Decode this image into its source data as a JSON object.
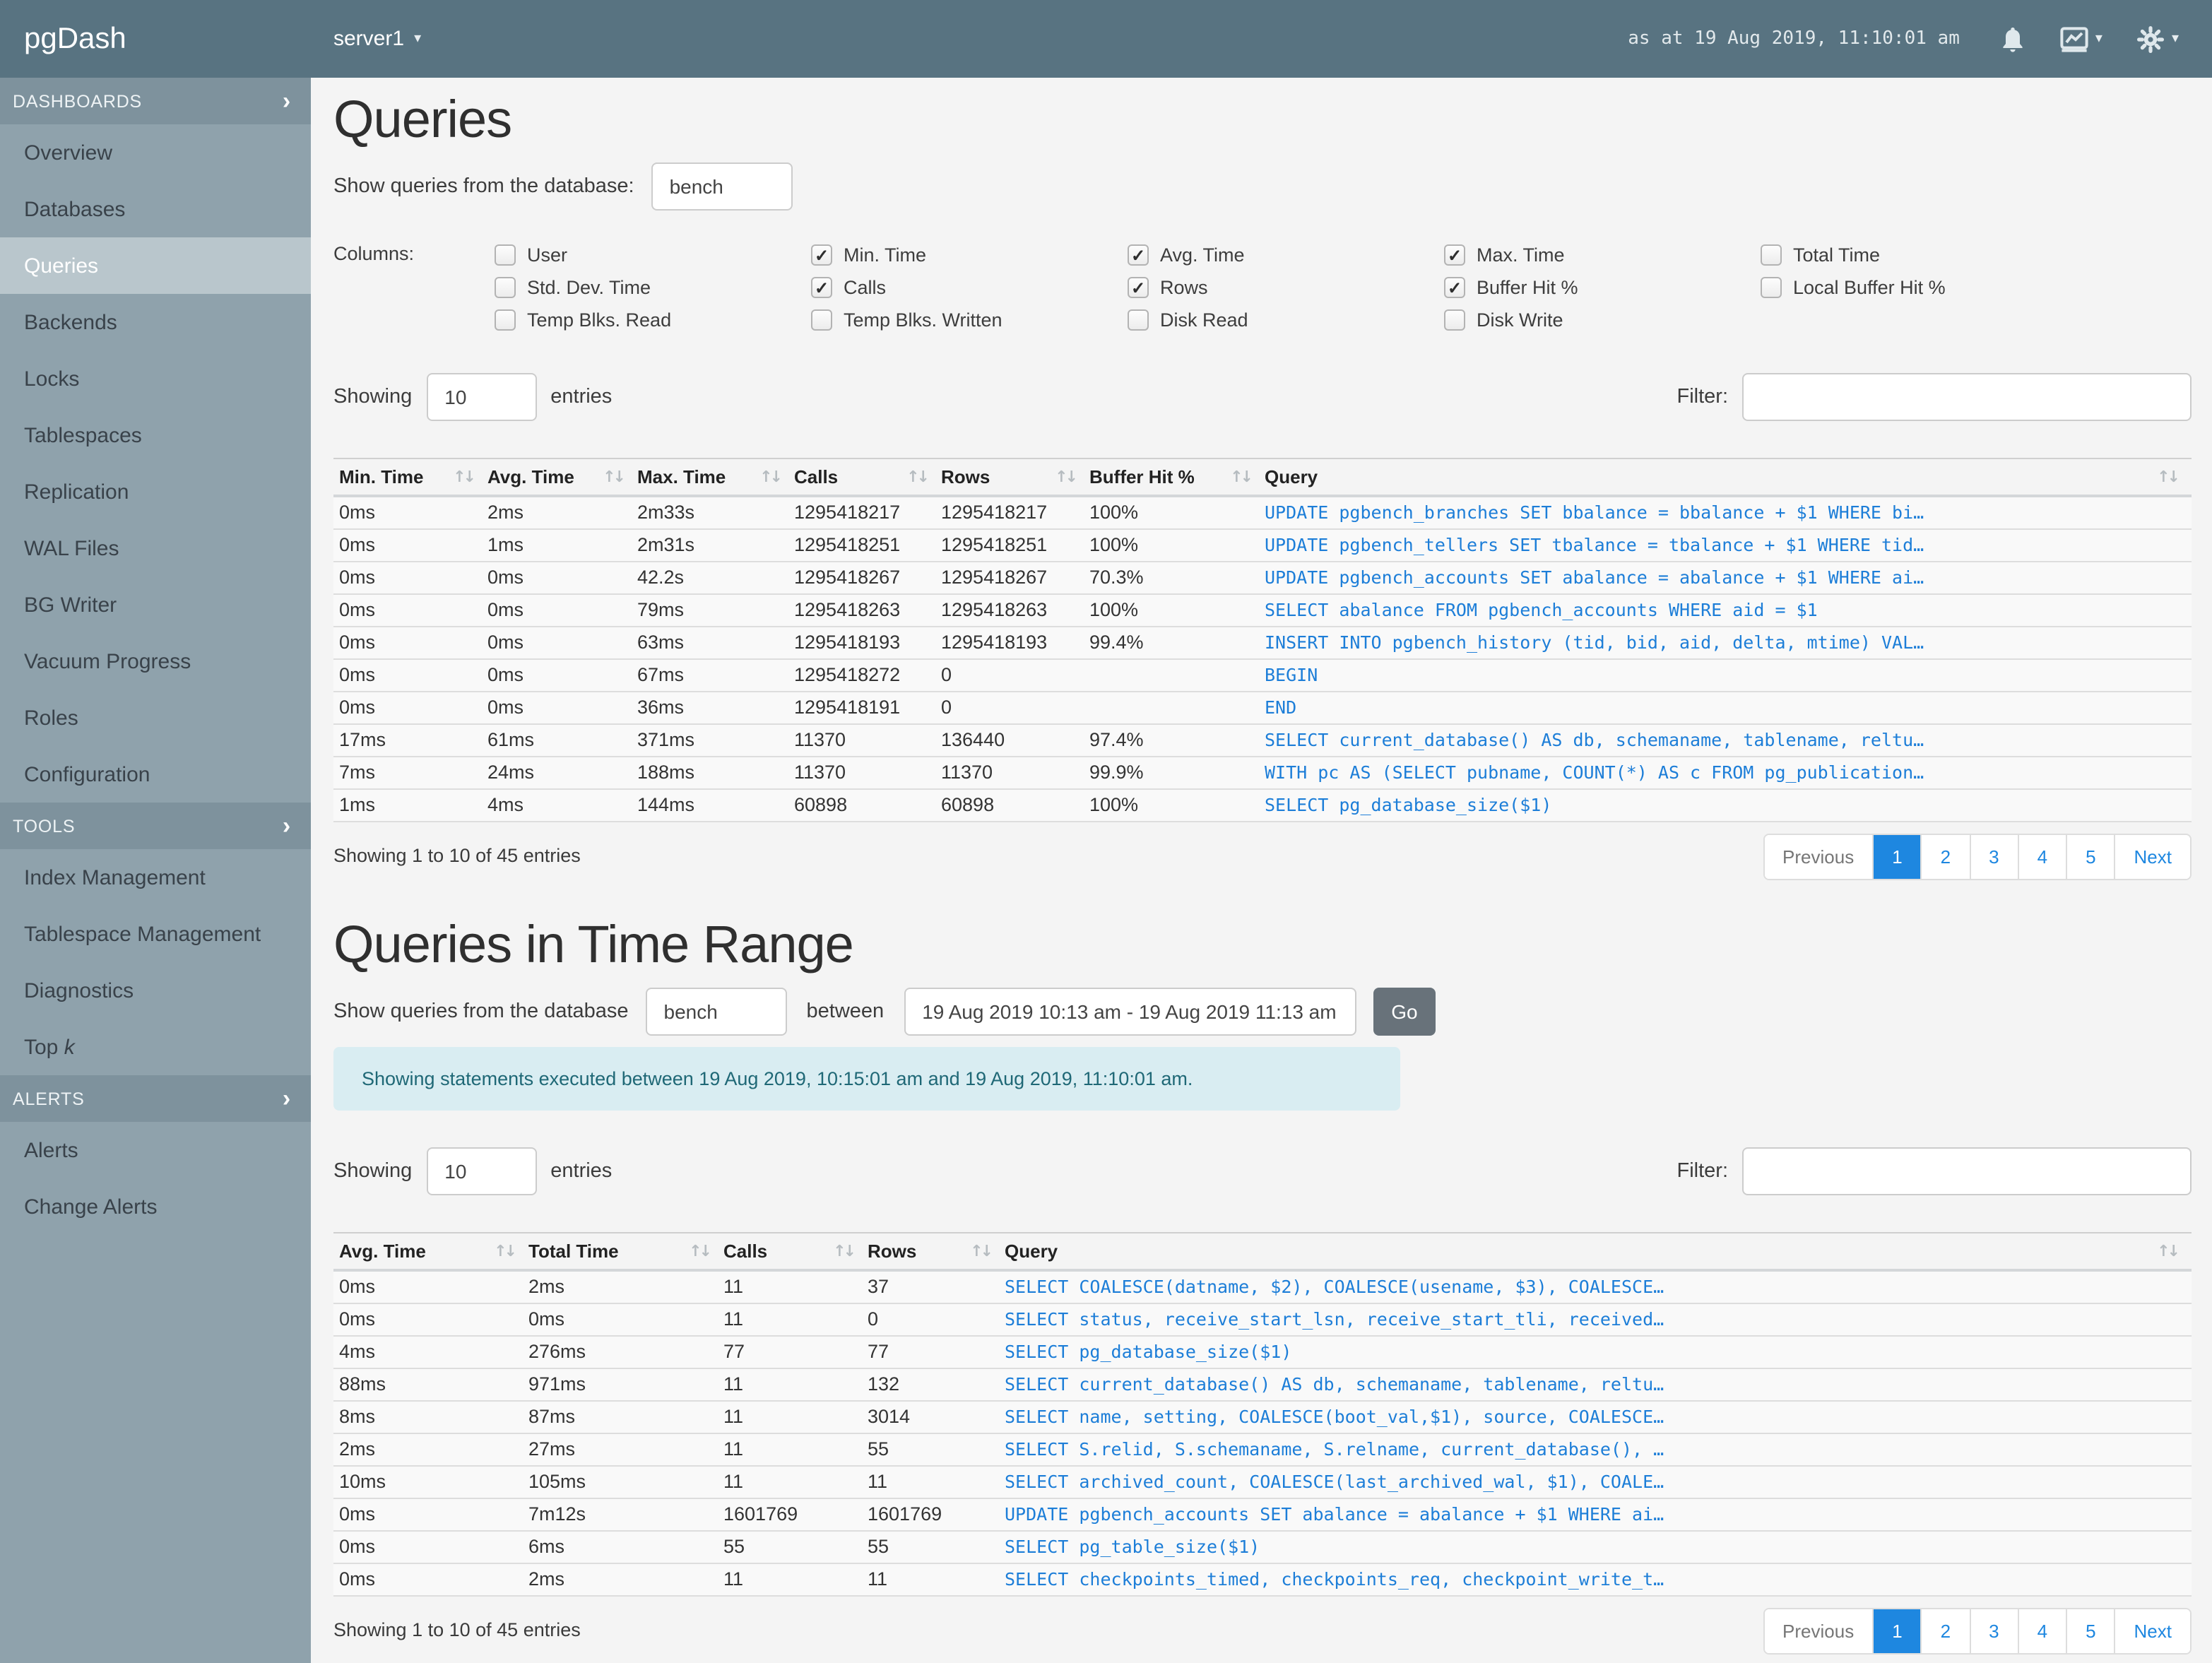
{
  "colors": {
    "topbar_bg": "#587381",
    "sidebar_bg": "#8fa2ac",
    "sidebar_section_bg": "#7e929d",
    "sidebar_active_bg": "#b9c6cc",
    "link_blue": "#1d7ed8",
    "pagination_active_blue": "#1e87e0",
    "alert_bg": "#d9edf2",
    "alert_text": "#1f6876",
    "go_button_bg": "#68727a"
  },
  "header": {
    "brand": "pgDash",
    "server": "server1",
    "as_at": "as at 19 Aug 2019, 11:10:01 am",
    "icons": [
      "bell",
      "chart-line",
      "gear"
    ]
  },
  "sidebar": {
    "sections": [
      {
        "label": "DASHBOARDS",
        "items": [
          {
            "label": "Overview"
          },
          {
            "label": "Databases"
          },
          {
            "label": "Queries",
            "active": true
          },
          {
            "label": "Backends"
          },
          {
            "label": "Locks"
          },
          {
            "label": "Tablespaces"
          },
          {
            "label": "Replication"
          },
          {
            "label": "WAL Files"
          },
          {
            "label": "BG Writer"
          },
          {
            "label": "Vacuum Progress"
          },
          {
            "label": "Roles"
          },
          {
            "label": "Configuration"
          }
        ]
      },
      {
        "label": "TOOLS",
        "items": [
          {
            "label": "Index Management"
          },
          {
            "label": "Tablespace Management"
          },
          {
            "label": "Diagnostics"
          },
          {
            "label": "Top ",
            "italic": "k"
          }
        ]
      },
      {
        "label": "ALERTS",
        "items": [
          {
            "label": "Alerts"
          },
          {
            "label": "Change Alerts"
          }
        ]
      }
    ]
  },
  "queries_section": {
    "title": "Queries",
    "db_label": "Show queries from the database:",
    "db_value": "bench",
    "columns_label": "Columns:",
    "checkbox_columns": [
      [
        {
          "label": "User",
          "checked": false
        },
        {
          "label": "Std. Dev. Time",
          "checked": false
        },
        {
          "label": "Temp Blks. Read",
          "checked": false
        }
      ],
      [
        {
          "label": "Min. Time",
          "checked": true
        },
        {
          "label": "Calls",
          "checked": true
        },
        {
          "label": "Temp Blks. Written",
          "checked": false
        }
      ],
      [
        {
          "label": "Avg. Time",
          "checked": true
        },
        {
          "label": "Rows",
          "checked": true
        },
        {
          "label": "Disk Read",
          "checked": false
        }
      ],
      [
        {
          "label": "Max. Time",
          "checked": true
        },
        {
          "label": "Buffer Hit %",
          "checked": true
        },
        {
          "label": "Disk Write",
          "checked": false
        }
      ],
      [
        {
          "label": "Total Time",
          "checked": false
        },
        {
          "label": "Local Buffer Hit %",
          "checked": false
        }
      ]
    ],
    "showing_label": "Showing",
    "page_size": "10",
    "entries_label": "entries",
    "filter_label": "Filter:",
    "filter_value": "",
    "table": {
      "headers": [
        "Min. Time",
        "Avg. Time",
        "Max. Time",
        "Calls",
        "Rows",
        "Buffer Hit %",
        "Query"
      ],
      "rows": [
        [
          "0ms",
          "2ms",
          "2m33s",
          "1295418217",
          "1295418217",
          "100%",
          "UPDATE pgbench_branches SET bbalance = bbalance + $1 WHERE bi…"
        ],
        [
          "0ms",
          "1ms",
          "2m31s",
          "1295418251",
          "1295418251",
          "100%",
          "UPDATE pgbench_tellers SET tbalance = tbalance + $1 WHERE tid…"
        ],
        [
          "0ms",
          "0ms",
          "42.2s",
          "1295418267",
          "1295418267",
          "70.3%",
          "UPDATE pgbench_accounts SET abalance = abalance + $1 WHERE ai…"
        ],
        [
          "0ms",
          "0ms",
          "79ms",
          "1295418263",
          "1295418263",
          "100%",
          "SELECT abalance FROM pgbench_accounts WHERE aid = $1"
        ],
        [
          "0ms",
          "0ms",
          "63ms",
          "1295418193",
          "1295418193",
          "99.4%",
          "INSERT INTO pgbench_history (tid, bid, aid, delta, mtime) VAL…"
        ],
        [
          "0ms",
          "0ms",
          "67ms",
          "1295418272",
          "0",
          "",
          "BEGIN"
        ],
        [
          "0ms",
          "0ms",
          "36ms",
          "1295418191",
          "0",
          "",
          "END"
        ],
        [
          "17ms",
          "61ms",
          "371ms",
          "11370",
          "136440",
          "97.4%",
          "SELECT current_database() AS db, schemaname, tablename, reltu…"
        ],
        [
          "7ms",
          "24ms",
          "188ms",
          "11370",
          "11370",
          "99.9%",
          "WITH pc AS (SELECT pubname, COUNT(*) AS c FROM pg_publication…"
        ],
        [
          "1ms",
          "4ms",
          "144ms",
          "60898",
          "60898",
          "100%",
          "SELECT pg_database_size($1)"
        ]
      ]
    },
    "summary": "Showing 1 to 10 of 45 entries",
    "pagination": {
      "prev": "Previous",
      "pages": [
        "1",
        "2",
        "3",
        "4",
        "5"
      ],
      "next": "Next",
      "active": "1"
    }
  },
  "time_range_section": {
    "title": "Queries in Time Range",
    "db_label": "Show queries from the database",
    "db_value": "bench",
    "between_label": "between",
    "range_value": "19 Aug 2019 10:13 am - 19 Aug 2019 11:13 am",
    "go_label": "Go",
    "alert": "Showing statements executed between 19 Aug 2019, 10:15:01 am and 19 Aug 2019, 11:10:01 am.",
    "showing_label": "Showing",
    "page_size": "10",
    "entries_label": "entries",
    "filter_label": "Filter:",
    "filter_value": "",
    "table": {
      "headers": [
        "Avg. Time",
        "Total Time",
        "Calls",
        "Rows",
        "Query"
      ],
      "rows": [
        [
          "0ms",
          "2ms",
          "11",
          "37",
          "SELECT COALESCE(datname, $2), COALESCE(usename, $3), COALESCE…"
        ],
        [
          "0ms",
          "0ms",
          "11",
          "0",
          "SELECT status, receive_start_lsn, receive_start_tli, received…"
        ],
        [
          "4ms",
          "276ms",
          "77",
          "77",
          "SELECT pg_database_size($1)"
        ],
        [
          "88ms",
          "971ms",
          "11",
          "132",
          "SELECT current_database() AS db, schemaname, tablename, reltu…"
        ],
        [
          "8ms",
          "87ms",
          "11",
          "3014",
          "SELECT name, setting, COALESCE(boot_val,$1), source, COALESCE…"
        ],
        [
          "2ms",
          "27ms",
          "11",
          "55",
          "SELECT S.relid, S.schemaname, S.relname, current_database(), …"
        ],
        [
          "10ms",
          "105ms",
          "11",
          "11",
          "SELECT archived_count, COALESCE(last_archived_wal, $1), COALE…"
        ],
        [
          "0ms",
          "7m12s",
          "1601769",
          "1601769",
          "UPDATE pgbench_accounts SET abalance = abalance + $1 WHERE ai…"
        ],
        [
          "0ms",
          "6ms",
          "55",
          "55",
          "SELECT pg_table_size($1)"
        ],
        [
          "0ms",
          "2ms",
          "11",
          "11",
          "SELECT checkpoints_timed, checkpoints_req, checkpoint_write_t…"
        ]
      ]
    },
    "summary": "Showing 1 to 10 of 45 entries",
    "pagination": {
      "prev": "Previous",
      "pages": [
        "1",
        "2",
        "3",
        "4",
        "5"
      ],
      "next": "Next",
      "active": "1"
    }
  }
}
